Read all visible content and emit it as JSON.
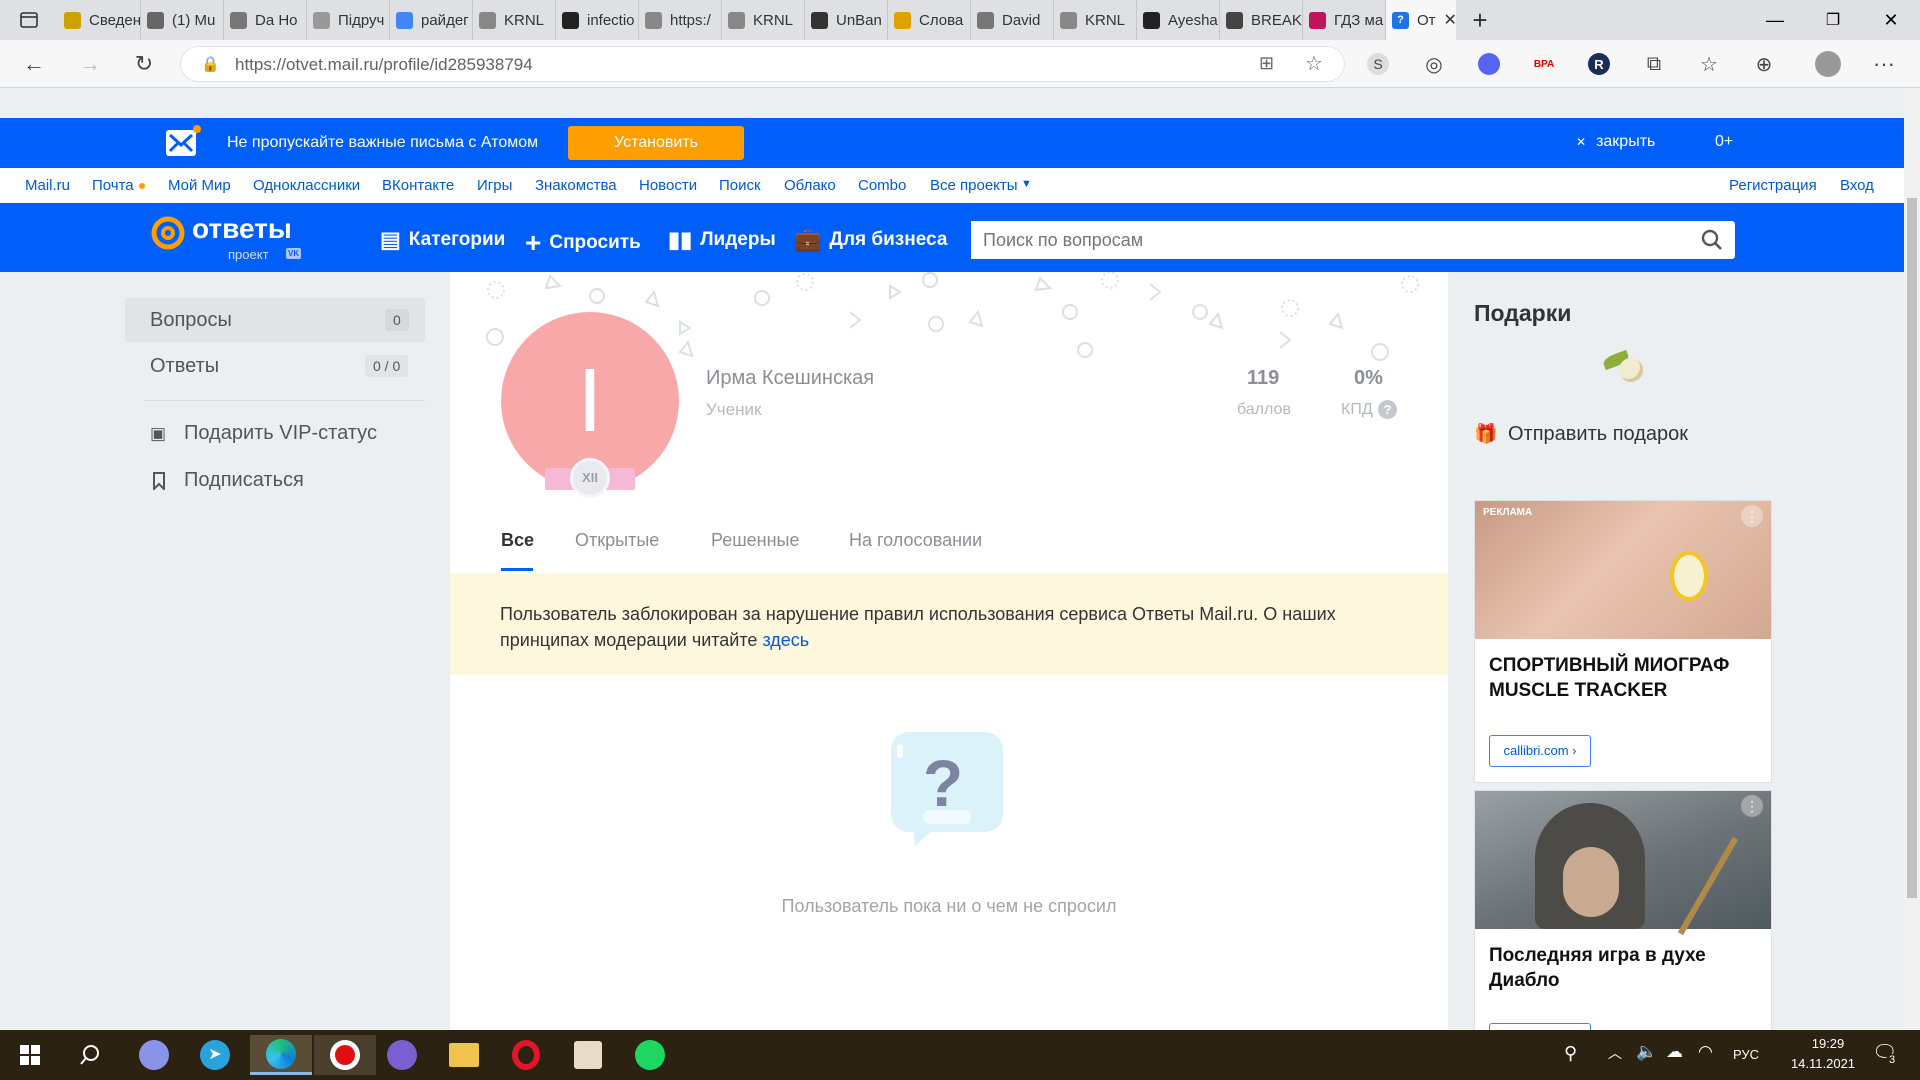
{
  "browser": {
    "tabs": [
      {
        "label": "Сведен",
        "color": "#c9a400"
      },
      {
        "label": "(1) Mu",
        "color": "#666"
      },
      {
        "label": "Da Ho",
        "color": "#777"
      },
      {
        "label": "Підруч",
        "color": "#999"
      },
      {
        "label": "райдег",
        "color": "#4285f4"
      },
      {
        "label": "KRNL",
        "color": "#888"
      },
      {
        "label": "infectio",
        "color": "#222"
      },
      {
        "label": "https:/",
        "color": "#888"
      },
      {
        "label": "KRNL",
        "color": "#888"
      },
      {
        "label": "UnBan",
        "color": "#333"
      },
      {
        "label": "Слова",
        "color": "#e0a000"
      },
      {
        "label": "David",
        "color": "#777"
      },
      {
        "label": "KRNL",
        "color": "#888"
      },
      {
        "label": "Ayesha",
        "color": "#222"
      },
      {
        "label": "BREAK",
        "color": "#444"
      },
      {
        "label": "ГДЗ ма",
        "color": "#c0145c"
      }
    ],
    "active_tab": {
      "label": "От",
      "color": "#1a73e8"
    },
    "url": "https://otvet.mail.ru/profile/id285938794"
  },
  "promo": {
    "text": "Не пропускайте важные письма с Атомом",
    "install": "Установить",
    "close": "закрыть",
    "age": "0+"
  },
  "topnav": {
    "links": [
      "Mail.ru",
      "Почта",
      "Мой Мир",
      "Одноклассники",
      "ВКонтакте",
      "Игры",
      "Знакомства",
      "Новости",
      "Поиск",
      "Облако",
      "Combo",
      "Все проекты"
    ],
    "register": "Регистрация",
    "login": "Вход"
  },
  "header": {
    "logo": "ответы",
    "logo_sub": "проект",
    "logo_badge": "VK",
    "nav": [
      "Категории",
      "Спросить",
      "Лидеры",
      "Для бизнеса"
    ],
    "search_placeholder": "Поиск по вопросам"
  },
  "sidebar": {
    "questions": "Вопросы",
    "questions_count": "0",
    "answers": "Ответы",
    "answers_count": "0 / 0",
    "vip": "Подарить VIP-статус",
    "subscribe": "Подписаться"
  },
  "profile": {
    "avatar_letter": "I",
    "level_badge": "XII",
    "name": "Ирма Ксешинская",
    "rank": "Ученик",
    "points": "119",
    "points_label": "баллов",
    "kpd": "0%",
    "kpd_label": "КПД",
    "tabs": [
      "Все",
      "Открытые",
      "Решенные",
      "На голосовании"
    ],
    "notice": "Пользователь заблокирован за нарушение правил использования сервиса Ответы Mail.ru. О наших принципах модерации читайте",
    "notice_link": "здесь",
    "empty": "Пользователь пока ни о чем не спросил"
  },
  "gifts": {
    "title": "Подарки",
    "send": "Отправить подарок"
  },
  "ads": [
    {
      "label": "РЕКЛАМА",
      "title": "СПОРТИВНЫЙ МИОГРАФ MUSCLE TRACKER",
      "button": "callibri.com ›"
    },
    {
      "title": "Последняя игра в духе Диабло"
    }
  ],
  "taskbar": {
    "lang": "РУС",
    "time": "19:29",
    "date": "14.11.2021",
    "notif": "3"
  },
  "colors": {
    "brand_blue": "#005ff9",
    "install_orange": "#ff9e00",
    "avatar": "#f9a8aa"
  }
}
